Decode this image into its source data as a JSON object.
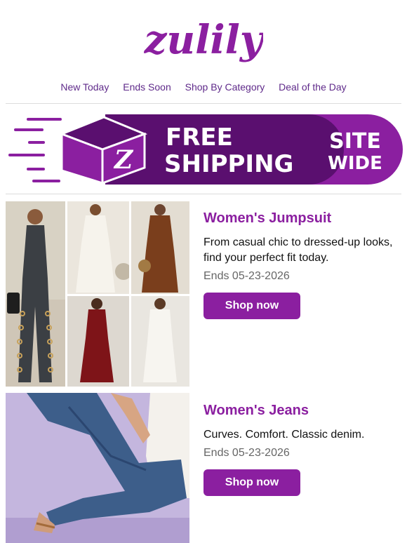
{
  "brand": {
    "logo_text": "zulily",
    "accent": "#8b1fa0",
    "nav_color": "#5f2a8a"
  },
  "nav": {
    "items": [
      "New Today",
      "Ends Soon",
      "Shop By Category",
      "Deal of the Day"
    ]
  },
  "banner": {
    "line1": "FREE",
    "line2": "SHIPPING",
    "badge1": "SITE",
    "badge2": "WIDE",
    "box_letter": "Z",
    "color_dark": "#5a0f6f",
    "color_main": "#8b1fa0"
  },
  "products": [
    {
      "title": "Women's Jumpsuit",
      "description": "From casual chic to dressed-up looks, find your perfect fit today.",
      "ends": "Ends 05-23-2026",
      "button": "Shop now"
    },
    {
      "title": "Women's Jeans",
      "description": "Curves. Comfort. Classic denim.",
      "ends": "Ends 05-23-2026",
      "button": "Shop now"
    }
  ]
}
